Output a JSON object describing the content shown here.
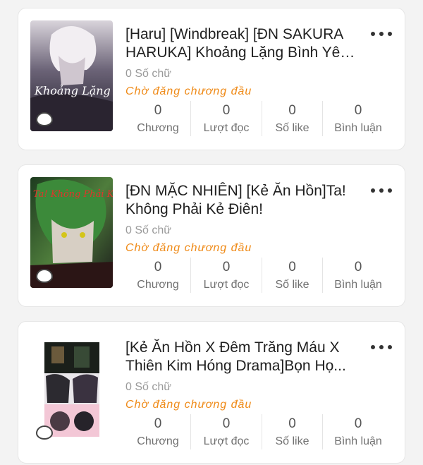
{
  "stories": [
    {
      "title": "[Haru] [Windbreak] [ĐN SAKURA HARUKA] Khoảng Lặng Bình Yên ...",
      "word_count": "0 Số chữ",
      "status": "Chờ đăng chương đầu",
      "cover_text": "Khoảng Lặng Bình Yên ...",
      "stats": [
        {
          "value": "0",
          "label": "Chương"
        },
        {
          "value": "0",
          "label": "Lượt đọc"
        },
        {
          "value": "0",
          "label": "Số like"
        },
        {
          "value": "0",
          "label": "Bình luận"
        }
      ]
    },
    {
      "title": "[ĐN MẶC NHIÊN] [Kẻ Ăn Hồn]Ta! Không Phải Kẻ Điên!",
      "word_count": "0 Số chữ",
      "status": "Chờ đăng chương đầu",
      "cover_text": "Ta! Không Phải Kẻ Điên!",
      "stats": [
        {
          "value": "0",
          "label": "Chương"
        },
        {
          "value": "0",
          "label": "Lượt đọc"
        },
        {
          "value": "0",
          "label": "Số like"
        },
        {
          "value": "0",
          "label": "Bình luận"
        }
      ]
    },
    {
      "title": "[Kẻ Ăn Hồn X Đêm Trăng Máu X Thiên Kim Hóng Drama]Bọn Họ...",
      "word_count": "0 Số chữ",
      "status": "Chờ đăng chương đầu",
      "cover_text": "",
      "stats": [
        {
          "value": "0",
          "label": "Chương"
        },
        {
          "value": "0",
          "label": "Lượt đọc"
        },
        {
          "value": "0",
          "label": "Số like"
        },
        {
          "value": "0",
          "label": "Bình luận"
        }
      ]
    }
  ],
  "icons": {
    "more": "more-horizontal-icon",
    "badge": "chat-bubble-icon"
  }
}
